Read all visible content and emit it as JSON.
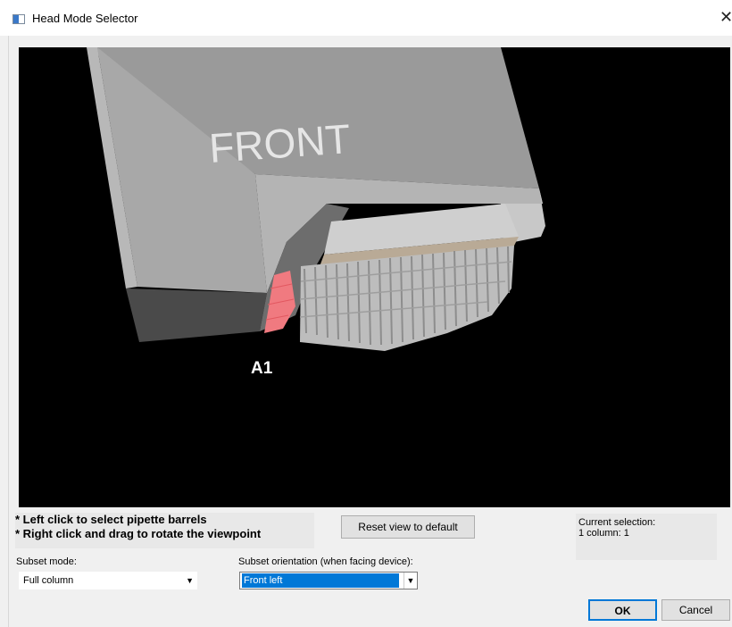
{
  "window": {
    "title": "Head Mode Selector",
    "close_glyph": "✕",
    "icon": "app-window-icon"
  },
  "viewport": {
    "front_label": "FRONT",
    "position_label": "A1",
    "background": "#000000",
    "highlight_color": "#f07a80"
  },
  "instructions": {
    "line1": "* Left click to select pipette barrels",
    "line2": "* Right click and drag to rotate the viewpoint"
  },
  "reset_button": {
    "label": "Reset view to default"
  },
  "current_selection": {
    "heading": "Current selection:",
    "value": "1 column: 1"
  },
  "subset_mode": {
    "label": "Subset mode:",
    "value": "Full column",
    "icon": "chevron-down-icon"
  },
  "subset_orientation": {
    "label": "Subset orientation (when facing device):",
    "value": "Front left",
    "icon": "chevron-down-icon"
  },
  "actions": {
    "ok_label": "OK",
    "cancel_label": "Cancel",
    "accent": "#0078d7"
  }
}
